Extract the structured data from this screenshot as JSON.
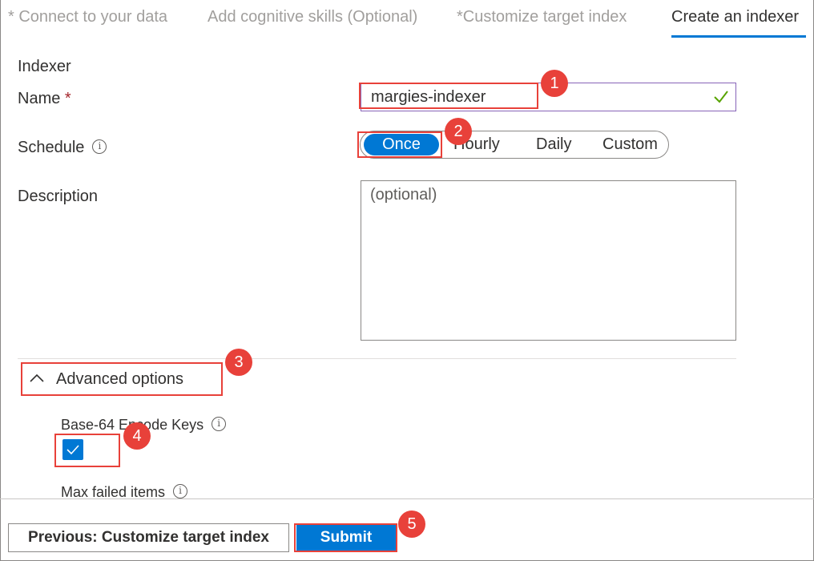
{
  "tabs": [
    {
      "label": "Connect to your data",
      "required": true,
      "active": false
    },
    {
      "label": "Add cognitive skills (Optional)",
      "required": false,
      "active": false
    },
    {
      "label": "Customize target index",
      "required": true,
      "active": false
    },
    {
      "label": "Create an indexer",
      "required": false,
      "active": true
    }
  ],
  "required_marker": "*",
  "section_title": "Indexer",
  "name": {
    "label": "Name",
    "required_star": "*",
    "value": "margies-indexer",
    "valid_icon": "check-icon"
  },
  "schedule": {
    "label": "Schedule",
    "info_icon": "i",
    "options": [
      "Once",
      "Hourly",
      "Daily",
      "Custom"
    ],
    "selected": "Once"
  },
  "description": {
    "label": "Description",
    "placeholder": "(optional)"
  },
  "advanced": {
    "label": "Advanced options",
    "expanded": true
  },
  "base64": {
    "label": "Base-64 Encode Keys",
    "info_icon": "i",
    "checked": true
  },
  "max_failed": {
    "label": "Max failed items",
    "info_icon": "i"
  },
  "buttons": {
    "previous": "Previous: Customize target index",
    "submit": "Submit"
  },
  "callouts": [
    "1",
    "2",
    "3",
    "4",
    "5"
  ],
  "colors": {
    "accent": "#0078d4",
    "callout": "#e8413a",
    "valid": "#57a300"
  }
}
